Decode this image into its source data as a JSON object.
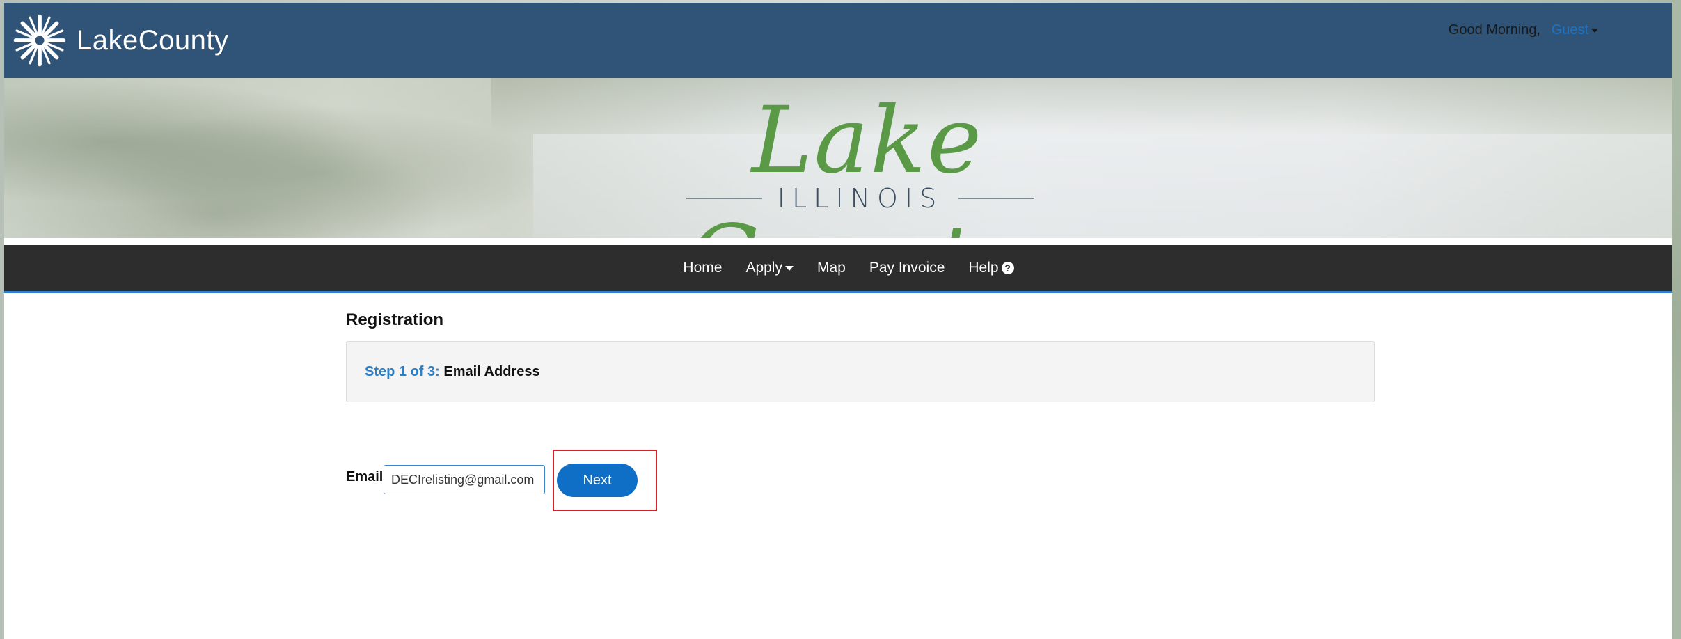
{
  "header": {
    "brand": "LakeCounty",
    "greeting": "Good Morning,",
    "user": "Guest"
  },
  "banner": {
    "title": "Lake County,",
    "subtitle": "ILLINOIS"
  },
  "nav": {
    "items": [
      {
        "label": "Home"
      },
      {
        "label": "Apply"
      },
      {
        "label": "Map"
      },
      {
        "label": "Pay Invoice"
      },
      {
        "label": "Help"
      }
    ],
    "help_glyph": "?"
  },
  "registration": {
    "title": "Registration",
    "step_label": "Step 1 of 3:",
    "step_name": "Email Address",
    "email_label": "Email",
    "email_value": "DECIrelisting@gmail.com",
    "next_label": "Next"
  },
  "colors": {
    "header_bg": "#2f5478",
    "nav_bg": "#2d2d2d",
    "accent": "#0f6fc6",
    "highlight": "#d9202a",
    "banner_script": "#5a9a46"
  },
  "icons": {
    "logo": "snowflake-star-logo-icon",
    "caret": "caret-down-icon",
    "help": "question-circle-icon"
  }
}
